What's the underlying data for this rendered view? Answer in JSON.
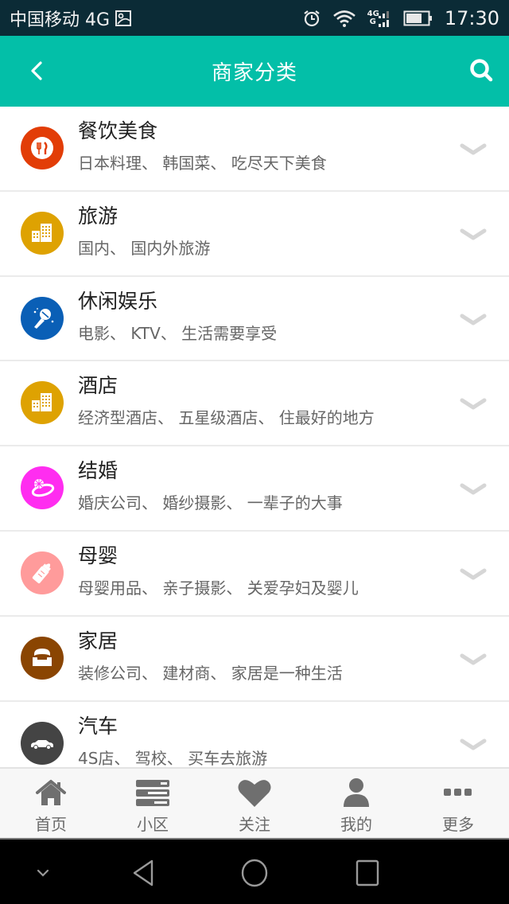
{
  "status_bar": {
    "carrier": "中国移动 4G",
    "network_top": "4G",
    "network_bottom": "G",
    "time": "17:30",
    "icons": [
      "image-icon",
      "alarm-icon",
      "wifi-icon",
      "signal-icon",
      "battery-icon"
    ]
  },
  "header": {
    "title": "商家分类",
    "back_icon": "chevron-left-icon",
    "search_icon": "search-icon",
    "bg_color": "#03bfa8"
  },
  "categories": [
    {
      "name": "餐饮美食",
      "desc": "日本料理、 韩国菜、 吃尽天下美食",
      "icon": "fork-knife-icon",
      "color": "#e23d07"
    },
    {
      "name": "旅游",
      "desc": "国内、 国内外旅游",
      "icon": "buildings-icon",
      "color": "#dea202"
    },
    {
      "name": "休闲娱乐",
      "desc": "电影、 KTV、 生活需要享受",
      "icon": "microphone-icon",
      "color": "#0a5fb6"
    },
    {
      "name": "酒店",
      "desc": "经济型酒店、 五星级酒店、 住最好的地方",
      "icon": "buildings-icon",
      "color": "#dea202"
    },
    {
      "name": "结婚",
      "desc": "婚庆公司、 婚纱摄影、 一辈子的大事",
      "icon": "ring-icon",
      "color": "#ff2df0"
    },
    {
      "name": "母婴",
      "desc": "母婴用品、 亲子摄影、 关爱孕妇及婴儿",
      "icon": "baby-bottle-icon",
      "color": "#ff9b9b"
    },
    {
      "name": "家居",
      "desc": "装修公司、 建材商、 家居是一种生活",
      "icon": "armchair-icon",
      "color": "#8a4502"
    },
    {
      "name": "汽车",
      "desc": "4S店、 驾校、 买车去旅游",
      "icon": "car-icon",
      "color": "#444444"
    }
  ],
  "tabbar": [
    {
      "label": "首页",
      "icon": "home-icon"
    },
    {
      "label": "小区",
      "icon": "list-icon"
    },
    {
      "label": "关注",
      "icon": "heart-icon"
    },
    {
      "label": "我的",
      "icon": "user-icon"
    },
    {
      "label": "更多",
      "icon": "more-icon"
    }
  ],
  "navbar": {
    "icons": [
      "hide-chevron-icon",
      "back-triangle-icon",
      "home-circle-icon",
      "recents-square-icon"
    ]
  }
}
